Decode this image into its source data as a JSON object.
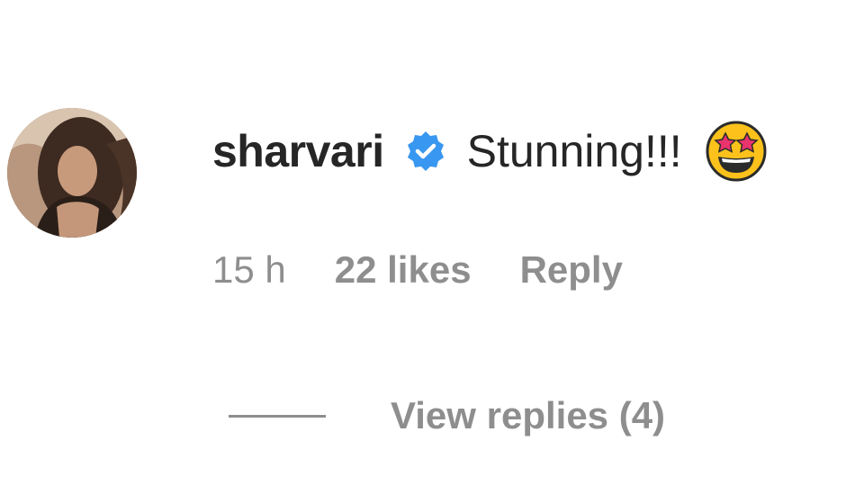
{
  "comment": {
    "avatar_icon": "user-avatar-photo",
    "username": "sharvari",
    "verified_icon": "verified-badge-icon",
    "verified_color": "#3897f0",
    "text": "Stunning!!!",
    "emoji_icon": "star-struck-emoji",
    "time": "15 h",
    "likes": "22 likes",
    "reply_label": "Reply",
    "view_replies_label": "View replies (4)"
  }
}
